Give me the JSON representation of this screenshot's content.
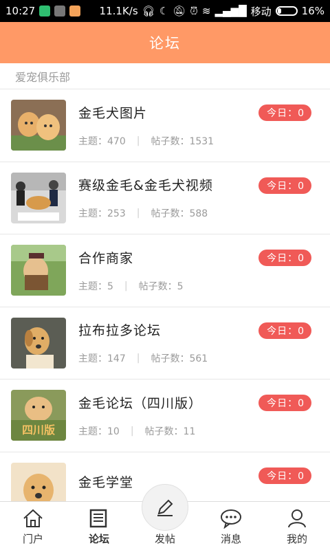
{
  "status_bar": {
    "time": "10:27",
    "speed": "11.1K/s",
    "carrier": "移动",
    "battery": "16%"
  },
  "header": {
    "title": "论坛"
  },
  "section": {
    "title": "爱宠俱乐部"
  },
  "forums": [
    {
      "name": "金毛犬图片",
      "topics_label": "主题：470",
      "posts_label": "帖子数：1531",
      "today": "今日：0"
    },
    {
      "name": "赛级金毛&金毛犬视频",
      "topics_label": "主题：253",
      "posts_label": "帖子数：588",
      "today": "今日：0"
    },
    {
      "name": "合作商家",
      "topics_label": "主题：5",
      "posts_label": "帖子数：5",
      "today": "今日：0"
    },
    {
      "name": "拉布拉多论坛",
      "topics_label": "主题：147",
      "posts_label": "帖子数：561",
      "today": "今日：0"
    },
    {
      "name": "金毛论坛（四川版）",
      "topics_label": "主题：10",
      "posts_label": "帖子数：11",
      "today": "今日：0"
    },
    {
      "name": "金毛学堂",
      "topics_label": "",
      "posts_label": "",
      "today": "今日：0"
    }
  ],
  "thumb_text": {
    "sichuan": "四川版"
  },
  "nav": [
    {
      "label": "门户",
      "icon": "home-icon"
    },
    {
      "label": "论坛",
      "icon": "book-icon"
    },
    {
      "label": "发帖",
      "icon": "pen-icon"
    },
    {
      "label": "消息",
      "icon": "chat-icon"
    },
    {
      "label": "我的",
      "icon": "person-icon"
    }
  ],
  "colors": {
    "header": "#ff9966",
    "badge": "#f05a57"
  }
}
